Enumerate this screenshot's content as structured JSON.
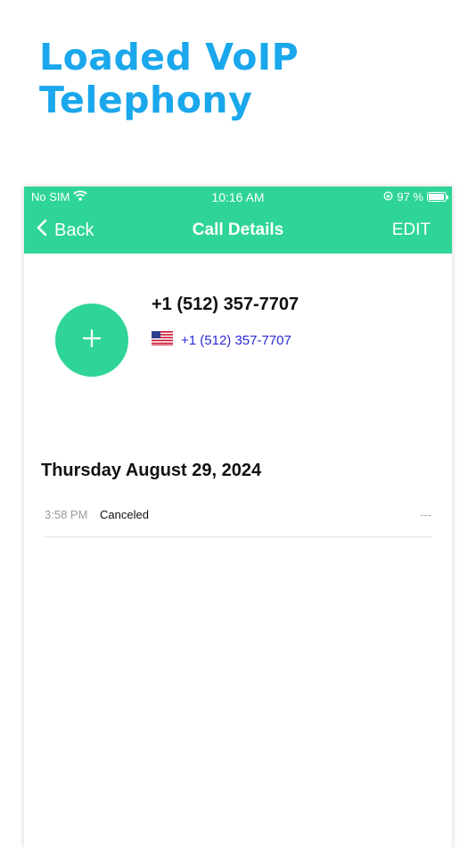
{
  "headline": {
    "line1": "Loaded VoIP",
    "line2": "Telephony"
  },
  "colors": {
    "headline": "#1aa7ec",
    "accent": "#2ed597",
    "link": "#2a2ad8"
  },
  "status_bar": {
    "carrier": "No SIM",
    "time": "10:16 AM",
    "battery": "97 %",
    "battery_level": 0.97
  },
  "nav": {
    "back_label": "Back",
    "title": "Call Details",
    "edit_label": "EDIT"
  },
  "contact": {
    "name": "+1 (512) 357-7707",
    "number": "+1 (512) 357-7707",
    "flag": "us-flag-icon"
  },
  "call_log": {
    "date": "Thursday August 29, 2024",
    "entries": [
      {
        "time": "3:58 PM",
        "status": "Canceled",
        "duration": "---"
      }
    ]
  }
}
